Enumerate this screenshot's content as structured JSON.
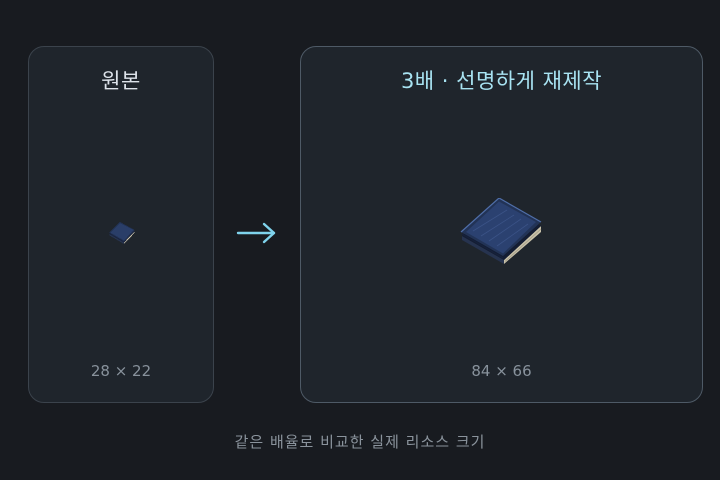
{
  "original": {
    "title": "원본",
    "dimensions": "28 × 22",
    "icon": "book-icon"
  },
  "upscaled": {
    "title": "3배 · 선명하게 재제작",
    "dimensions": "84 × 66",
    "icon": "book-icon"
  },
  "arrow_icon": "arrow-right-icon",
  "caption": "같은 배율로 비교한 실제 리소스 크기",
  "colors": {
    "background": "#181b20",
    "panel": "#1f252c",
    "accent": "#7fd3ec",
    "book_cover": "#223356",
    "book_pages": "#c9c2aa"
  }
}
